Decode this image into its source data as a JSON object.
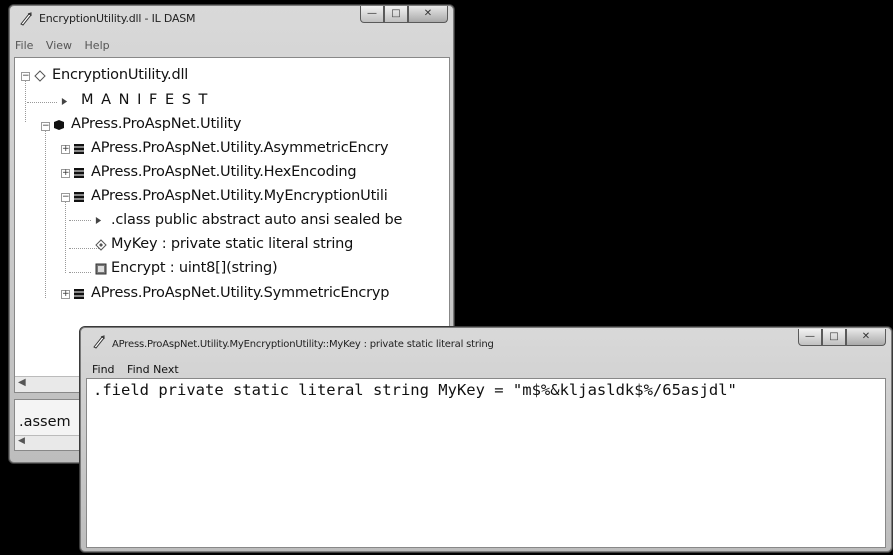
{
  "ildasm": {
    "title": "EncryptionUtility.dll - IL DASM",
    "menu": [
      "File",
      "View",
      "Help"
    ],
    "tree": {
      "root": "EncryptionUtility.dll",
      "manifest": "M A N I F E S T",
      "namespace": "APress.ProAspNet.Utility",
      "classes": [
        "APress.ProAspNet.Utility.AsymmetricEncry",
        "APress.ProAspNet.Utility.HexEncoding",
        "APress.ProAspNet.Utility.MyEncryptionUtili"
      ],
      "members": [
        ".class public abstract auto ansi sealed be",
        "MyKey : private static literal string",
        "Encrypt : uint8[](string)"
      ],
      "last_class": "APress.ProAspNet.Utility.SymmetricEncryp"
    },
    "bottom_text": ".assem"
  },
  "viewer": {
    "title": "APress.ProAspNet.Utility.MyEncryptionUtility::MyKey : private static literal string",
    "menu": [
      "Find",
      "Find Next"
    ],
    "content": ".field private static literal string MyKey = \"m$%&kljasldk$%/65asjdl\""
  },
  "colors": {
    "background": "#000000",
    "chrome": "#cfcfcf",
    "client": "#ffffff"
  }
}
